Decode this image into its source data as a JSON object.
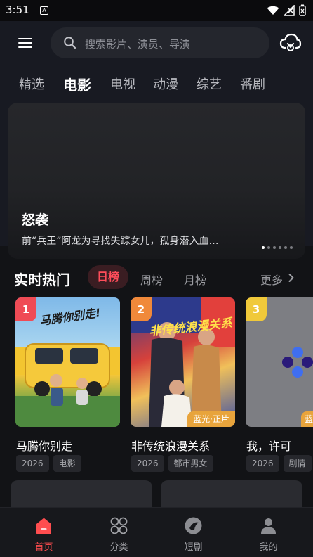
{
  "status_bar": {
    "time": "3:51",
    "notice_icon": "A"
  },
  "search": {
    "placeholder": "搜索影片、演员、导演"
  },
  "category_tabs": [
    "精选",
    "电影",
    "电视",
    "动漫",
    "综艺",
    "番剧"
  ],
  "active_category": "电影",
  "banner": {
    "title": "怒袭",
    "description": "前“兵王”阿龙为寻找失踪女儿，孤身潜入血…",
    "slide_count": 6,
    "active_slide": 1
  },
  "hot": {
    "title": "实时热门",
    "rank_tabs": [
      "日榜",
      "周榜",
      "月榜"
    ],
    "active_rank_tab": "日榜",
    "more_label": "更多"
  },
  "cards": [
    {
      "rank": "1",
      "title": "马腾你别走",
      "year": "2026",
      "genre": "电影",
      "badge_color": "#ef4b55",
      "poster_text": "马腾你别走!"
    },
    {
      "rank": "2",
      "title": "非传统浪漫关系",
      "year": "2026",
      "genre": "都市男女",
      "badge_color": "#f0893a",
      "quality": "蓝光·正片",
      "poster_text": "非传统浪漫关系"
    },
    {
      "rank": "3",
      "title": "我，许可",
      "year": "2026",
      "genre": "剧情",
      "badge_color": "#f0c93a",
      "quality": "蓝"
    }
  ],
  "bottom_nav": [
    {
      "label": "首页",
      "icon": "home-icon",
      "active": true
    },
    {
      "label": "分类",
      "icon": "category-icon",
      "active": false
    },
    {
      "label": "短剧",
      "icon": "short-drama-icon",
      "active": false
    },
    {
      "label": "我的",
      "icon": "profile-icon",
      "active": false
    }
  ],
  "colors": {
    "accent": "#ff4d4f",
    "background": "#121316"
  }
}
